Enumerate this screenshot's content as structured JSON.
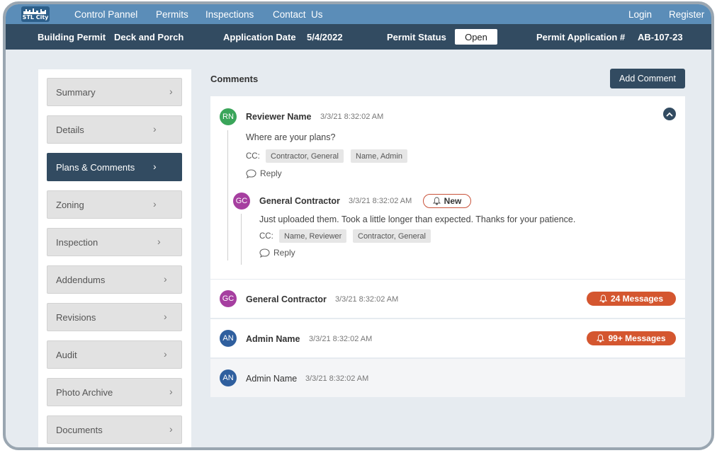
{
  "app": {
    "logo_text": "STL City"
  },
  "topnav": {
    "links": [
      "Control Pannel",
      "Permits",
      "Inspections",
      "Contact  Us"
    ],
    "login": "Login",
    "register": "Register"
  },
  "infobar": {
    "permit_label": "Building Permit",
    "permit_value": "Deck and Porch",
    "date_label": "Application Date",
    "date_value": "5/4/2022",
    "status_label": "Permit Status",
    "status_value": "Open",
    "app_no_label": "Permit Application #",
    "app_no_value": "AB-107-23"
  },
  "sidebar": {
    "items": [
      {
        "label": "Summary"
      },
      {
        "label": "Details"
      },
      {
        "label": "Plans & Comments",
        "active": true
      },
      {
        "label": "Zoning"
      },
      {
        "label": "Inspection"
      },
      {
        "label": "Addendums"
      },
      {
        "label": "Revisions"
      },
      {
        "label": "Audit"
      },
      {
        "label": "Photo Archive"
      },
      {
        "label": "Documents"
      }
    ]
  },
  "comments": {
    "title": "Comments",
    "add_label": "Add Comment",
    "cc_label": "CC:",
    "reply_label": "Reply",
    "threads": [
      {
        "initials": "RN",
        "author": "Reviewer Name",
        "time": "3/3/21 8:32:02 AM",
        "text": "Where are your plans?",
        "cc": [
          "Contractor, General",
          "Name, Admin"
        ],
        "reply": {
          "initials": "GC",
          "author": "General Contractor",
          "time": "3/3/21 8:32:02 AM",
          "badge": "New",
          "text": "Just uploaded them. Took a little longer than expected. Thanks for your patience.",
          "cc": [
            "Name, Reviewer",
            "Contractor, General"
          ]
        }
      },
      {
        "initials": "GC",
        "author": "General Contractor",
        "time": "3/3/21 8:32:02 AM",
        "badge": "24 Messages"
      },
      {
        "initials": "AN",
        "author": "Admin Name",
        "time": "3/3/21 8:32:02 AM",
        "badge": "99+ Messages"
      },
      {
        "initials": "AN",
        "author": "Admin Name",
        "time": "3/3/21 8:32:02 AM"
      }
    ]
  },
  "colors": {
    "navy": "#324b61",
    "topbar": "#5b8db8",
    "badge": "#d4562f",
    "green": "#3aa55a",
    "purple": "#a63fa0",
    "blue": "#2f5f9e"
  }
}
